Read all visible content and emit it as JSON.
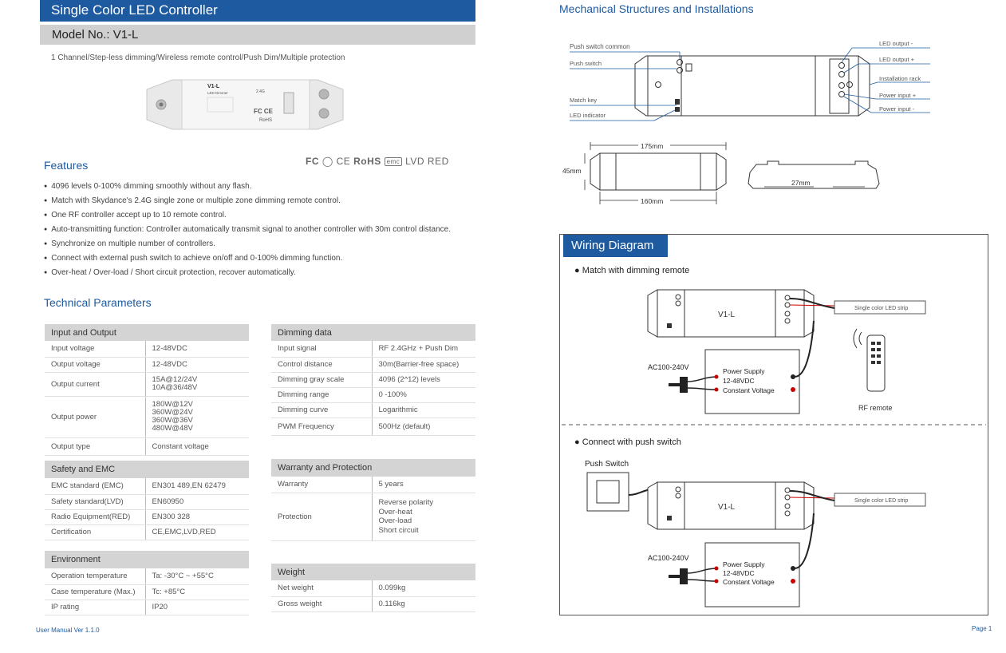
{
  "header": {
    "title": "Single Color LED Controller",
    "model": "Model No.: V1-L",
    "subtitle": "1 Channel/Step-less dimming/Wireless remote control/Push Dim/Multiple protection"
  },
  "product": {
    "name": "V1-L",
    "type": "LED Dimmer",
    "band": "2.4G",
    "cert": "FC CE",
    "rohs": "RoHS"
  },
  "features": {
    "heading": "Features",
    "items": [
      "4096 levels 0-100% dimming smoothly without any flash.",
      "Match with Skydance's 2.4G single zone or multiple zone dimming remote control.",
      "One RF controller accept up to 10 remote control.",
      "Auto-transmitting function: Controller automatically transmit signal to another controller with 30m control distance.",
      "Synchronize on multiple number of controllers.",
      "Connect with external push switch to achieve on/off and 0-100% dimming function.",
      "Over-heat / Over-load / Short circuit protection, recover automatically."
    ]
  },
  "certs": {
    "fc": "FC",
    "rohs": "RoHS",
    "emc": "emc",
    "lvd": "LVD",
    "red": "RED"
  },
  "tech": {
    "heading": "Technical Parameters",
    "io": {
      "title": "Input and Output",
      "rows": [
        [
          "Input voltage",
          "12-48VDC"
        ],
        [
          "Output voltage",
          "12-48VDC"
        ],
        [
          "Output current",
          "15A@12/24V\n10A@36/48V"
        ],
        [
          "Output power",
          "180W@12V\n360W@24V\n360W@36V\n480W@48V"
        ],
        [
          "Output type",
          "Constant voltage"
        ]
      ]
    },
    "dim": {
      "title": "Dimming data",
      "rows": [
        [
          "Input signal",
          "RF 2.4GHz + Push Dim"
        ],
        [
          "Control distance",
          "30m(Barrier-free space)"
        ],
        [
          "Dimming gray scale",
          "4096 (2^12) levels"
        ],
        [
          "Dimming range",
          "0 -100%"
        ],
        [
          "Dimming curve",
          "Logarithmic"
        ],
        [
          "PWM Frequency",
          "500Hz (default)"
        ]
      ]
    },
    "safety": {
      "title": "Safety and EMC",
      "rows": [
        [
          "EMC standard (EMC)",
          "EN301 489,EN 62479"
        ],
        [
          "Safety standard(LVD)",
          "EN60950"
        ],
        [
          "Radio Equipment(RED)",
          "EN300 328"
        ],
        [
          "Certification",
          "CE,EMC,LVD,RED"
        ]
      ]
    },
    "warranty": {
      "title": "Warranty and Protection",
      "rows": [
        [
          "Warranty",
          "5 years"
        ],
        [
          "Protection",
          "Reverse polarity\nOver-heat\nOver-load\nShort circuit"
        ]
      ]
    },
    "env": {
      "title": "Environment",
      "rows": [
        [
          "Operation temperature",
          "Ta: -30°C ~ +55°C"
        ],
        [
          "Case temperature (Max.)",
          "Tc: +85°C"
        ],
        [
          "IP rating",
          "IP20"
        ]
      ]
    },
    "weight": {
      "title": "Weight",
      "rows": [
        [
          "Net weight",
          "0.099kg"
        ],
        [
          "Gross weight",
          "0.116kg"
        ]
      ]
    }
  },
  "mech": {
    "heading": "Mechanical Structures and Installations",
    "left_labels": [
      "Push switch common",
      "Push switch",
      "Match key",
      "LED indicator"
    ],
    "right_labels": [
      "LED output -",
      "LED output +",
      "Installation rack",
      "Power input +",
      "Power input -"
    ],
    "dims": {
      "len": "175mm",
      "inner": "160mm",
      "height": "45mm",
      "depth": "27mm"
    }
  },
  "wiring": {
    "heading": "Wiring Diagram",
    "s1": "Match with dimming remote",
    "s2": "Connect with push switch",
    "device": "V1-L",
    "strip": "Single color LED strip",
    "ac": "AC100-240V",
    "psu": [
      "Power Supply",
      "12-48VDC",
      "Constant Voltage"
    ],
    "remote": "RF remote",
    "push": "Push Switch"
  },
  "footer": {
    "left": "User Manual Ver 1.1.0",
    "right": "Page 1"
  }
}
